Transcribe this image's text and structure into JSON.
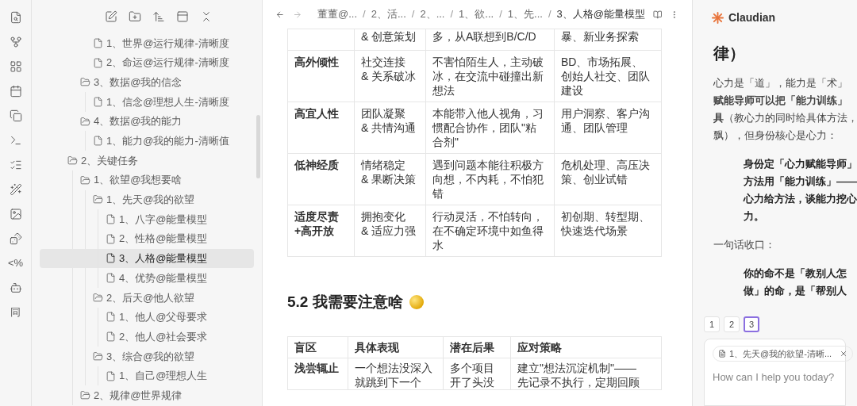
{
  "ribbon": [
    {
      "kind": "icon"
    },
    {
      "kind": "icon"
    },
    {
      "kind": "icon"
    },
    {
      "kind": "icon"
    },
    {
      "kind": "icon"
    },
    {
      "kind": "icon"
    },
    {
      "kind": "icon"
    },
    {
      "kind": "icon"
    },
    {
      "kind": "icon"
    },
    {
      "kind": "icon"
    },
    {
      "kind": "text",
      "text": "<%"
    },
    {
      "kind": "icon"
    },
    {
      "kind": "text",
      "text": "同"
    }
  ],
  "tree": [
    {
      "children": [
        {
          "children": [
            {
              "kind": "file",
              "label": "1、世界@运行规律-清晰度",
              "selected": false
            },
            {
              "kind": "file",
              "label": "2、命运@运行规律-清晰度",
              "selected": false
            }
          ]
        },
        {
          "kind": "folder",
          "label": "3、数据@我的信念",
          "children": [
            {
              "kind": "file",
              "label": "1、信念@理想人生-清晰度",
              "selected": false
            }
          ]
        },
        {
          "kind": "folder",
          "label": "4、数据@我的能力",
          "children": [
            {
              "kind": "file",
              "label": "1、能力@我的能力-清晰值",
              "selected": false
            }
          ]
        }
      ]
    },
    {
      "kind": "folder",
      "label": "2、关键任务",
      "children": [
        {
          "kind": "folder",
          "label": "1、欲望@我想要啥",
          "children": [
            {
              "kind": "folder",
              "label": "1、先天@我的欲望",
              "children": [
                {
                  "kind": "file",
                  "label": "1、八字@能量模型",
                  "selected": false
                },
                {
                  "kind": "file",
                  "label": "2、性格@能量模型",
                  "selected": false
                },
                {
                  "kind": "file",
                  "label": "3、人格@能量模型",
                  "selected": true
                },
                {
                  "kind": "file",
                  "label": "4、优势@能量模型",
                  "selected": false
                }
              ]
            },
            {
              "kind": "folder",
              "label": "2、后天@他人欲望",
              "children": [
                {
                  "kind": "file",
                  "label": "1、他人@父母要求",
                  "selected": false
                },
                {
                  "kind": "file",
                  "label": "2、他人@社会要求",
                  "selected": false
                }
              ]
            },
            {
              "kind": "folder",
              "label": "3、综合@我的欲望",
              "children": [
                {
                  "kind": "file",
                  "label": "1、自己@理想人生",
                  "selected": false
                }
              ]
            }
          ]
        },
        {
          "kind": "folder",
          "label": "2、规律@世界规律"
        }
      ]
    }
  ],
  "breadcrumb": [
    {
      "label": "董董@..."
    },
    {
      "separator": "/",
      "label": "2、活..."
    },
    {
      "separator": "/",
      "label": "2、..."
    },
    {
      "separator": "/",
      "label": "1、欲..."
    },
    {
      "separator": "/",
      "label": "1、先..."
    },
    {
      "separator": "/",
      "label": "3、人格@能量模型"
    }
  ],
  "table_1": {
    "rows": [
      [
        [],
        [
          "& 创意策划"
        ],
        [
          "多，从A联想到B/C/D"
        ],
        [
          "暴、新业务探索"
        ]
      ],
      [
        [
          "高外倾性"
        ],
        [
          "社交连接",
          "& 关系破冰"
        ],
        [
          "不害怕陌生人，主动破",
          "冰，在交流中碰撞出新",
          "想法"
        ],
        [
          "BD、市场拓展、",
          "创始人社交、团队",
          "建设"
        ]
      ],
      [
        [
          "高宜人性"
        ],
        [
          "团队凝聚",
          "& 共情沟通"
        ],
        [
          "本能带入他人视角，习",
          "惯配合协作，团队\"粘",
          "合剂\""
        ],
        [
          "用户洞察、客户沟",
          "通、团队管理"
        ]
      ],
      [
        [
          "低神经质"
        ],
        [
          "情绪稳定",
          "& 果断决策"
        ],
        [
          "遇到问题本能往积极方",
          "向想，不内耗，不怕犯",
          "错"
        ],
        [
          "危机处理、高压决",
          "策、创业试错"
        ]
      ],
      [
        [
          "适度尽责",
          "+高开放"
        ],
        [
          "拥抱变化",
          "& 适应力强"
        ],
        [
          "行动灵活，不怕转向，",
          "在不确定环境中如鱼得",
          "水"
        ],
        [
          "初创期、转型期、",
          "快速迭代场景"
        ]
      ]
    ]
  },
  "heading": "5.2 我需要注意啥",
  "table_2": {
    "columns": [
      "盲区",
      "具体表现",
      "潜在后果",
      "应对策略"
    ],
    "rows": [
      [
        [
          "浅尝辄止"
        ],
        [
          "一个想法没深入",
          "就跳到下一个"
        ],
        [
          "多个项目",
          "开了头没"
        ],
        [
          "建立\"想法沉淀机制\"——",
          "先记录不执行，定期回顾"
        ]
      ]
    ]
  },
  "assistant": {
    "title": "Claudian",
    "heading": "律）",
    "blocks": [
      {
        "kind": "para",
        "lines": [
          "心力是「道」，能力是「术」",
          "**赋能导师可以把「能力训练」**",
          "**具**（教心力的同时给具体方法，",
          "飘），但身份核心是心力："
        ]
      },
      {
        "kind": "quote",
        "lines": [
          "身份定「心力赋能导师」",
          "方法用「能力训练」——",
          "心力给方法，谈能力挖心",
          "力。"
        ]
      },
      {
        "kind": "para",
        "lines": [
          "一句话收口："
        ]
      },
      {
        "kind": "quote",
        "lines": [
          "你的命不是「教别人怎",
          "做」的命，是「帮别人"
        ]
      }
    ],
    "pages": [
      {
        "label": "1",
        "selected": false
      },
      {
        "label": "2",
        "selected": false
      },
      {
        "label": "3",
        "selected": true
      }
    ],
    "context_chip": "1、先天@我的欲望-清晰...",
    "input": {
      "placeholder": "How can I help you today?"
    }
  }
}
